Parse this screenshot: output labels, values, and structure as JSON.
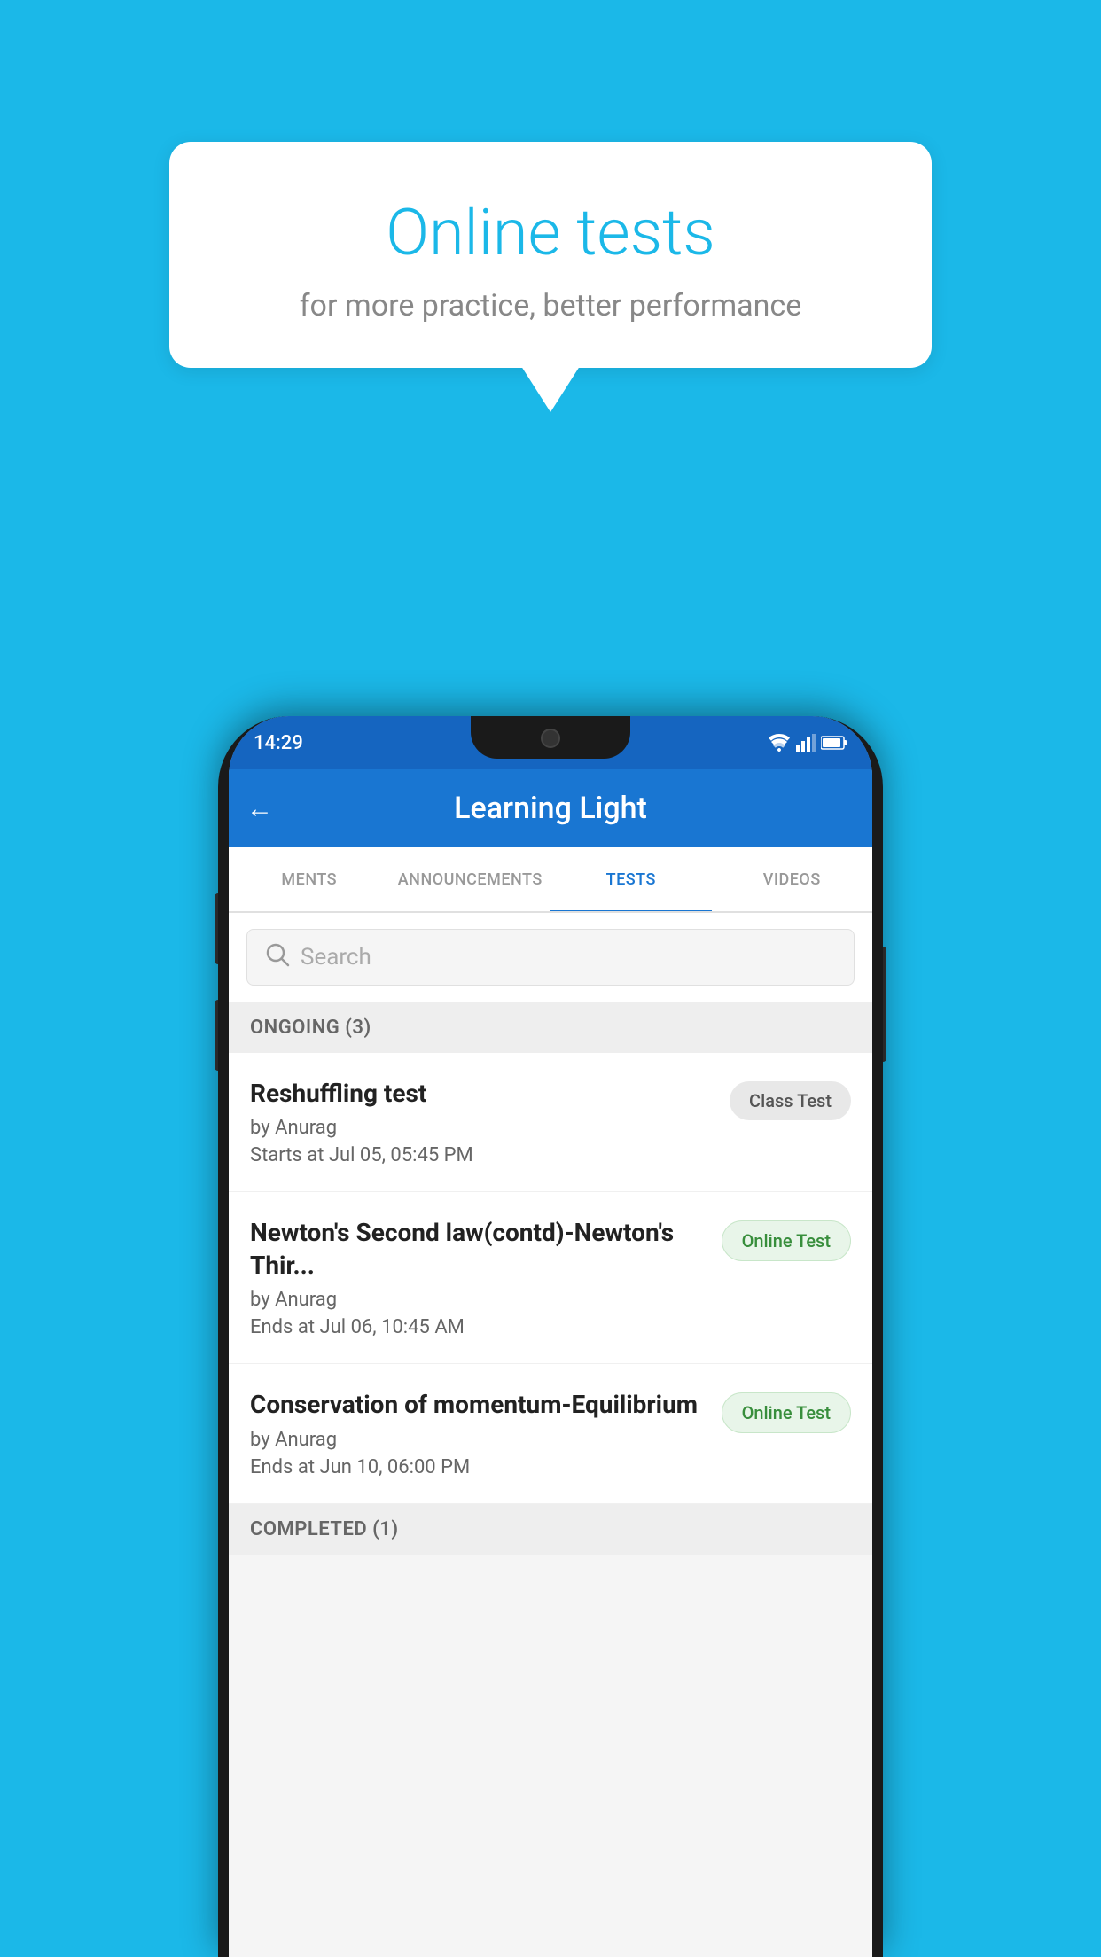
{
  "background_color": "#1BB8E8",
  "speech_bubble": {
    "title": "Online tests",
    "subtitle": "for more practice, better performance"
  },
  "phone": {
    "status_bar": {
      "time": "14:29"
    },
    "toolbar": {
      "title": "Learning Light",
      "back_label": "←"
    },
    "tabs": [
      {
        "label": "MENTS",
        "active": false
      },
      {
        "label": "ANNOUNCEMENTS",
        "active": false
      },
      {
        "label": "TESTS",
        "active": true
      },
      {
        "label": "VIDEOS",
        "active": false
      }
    ],
    "search": {
      "placeholder": "Search"
    },
    "sections": [
      {
        "title": "ONGOING (3)",
        "items": [
          {
            "name": "Reshuffling test",
            "author": "by Anurag",
            "date": "Starts at  Jul 05, 05:45 PM",
            "badge": "Class Test",
            "badge_type": "class"
          },
          {
            "name": "Newton's Second law(contd)-Newton's Thir...",
            "author": "by Anurag",
            "date": "Ends at  Jul 06, 10:45 AM",
            "badge": "Online Test",
            "badge_type": "online"
          },
          {
            "name": "Conservation of momentum-Equilibrium",
            "author": "by Anurag",
            "date": "Ends at  Jun 10, 06:00 PM",
            "badge": "Online Test",
            "badge_type": "online"
          }
        ]
      }
    ],
    "completed_section_title": "COMPLETED (1)"
  }
}
